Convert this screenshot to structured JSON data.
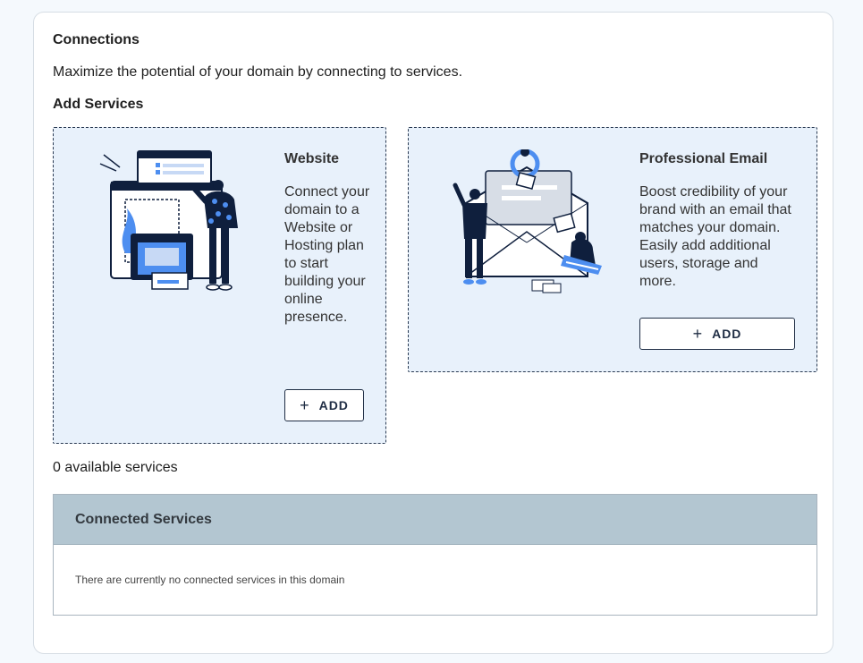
{
  "connections": {
    "title": "Connections",
    "subtitle": "Maximize the potential of your domain by connecting to services.",
    "add_services_heading": "Add Services"
  },
  "services": {
    "website": {
      "heading": "Website",
      "description": "Connect your domain to a Website or Hosting plan to start building your online presence.",
      "add_label": "ADD",
      "illustration_icon": "website-builder-illustration"
    },
    "email": {
      "heading": "Professional Email",
      "description": "Boost credibility of your brand with an email that matches your domain. Easily add additional users, storage and more.",
      "add_label": "ADD",
      "illustration_icon": "envelope-illustration"
    },
    "available_count": "0 available services"
  },
  "connected_services": {
    "heading": "Connected Services",
    "empty_message": "There are currently no connected services in this domain"
  },
  "colors": {
    "card_background": "#e8f1fb",
    "card_border": "#2a3a52",
    "header_background": "#b3c6d1",
    "illustration_navy": "#0f1f3d",
    "illustration_blue": "#4d8ef0"
  }
}
